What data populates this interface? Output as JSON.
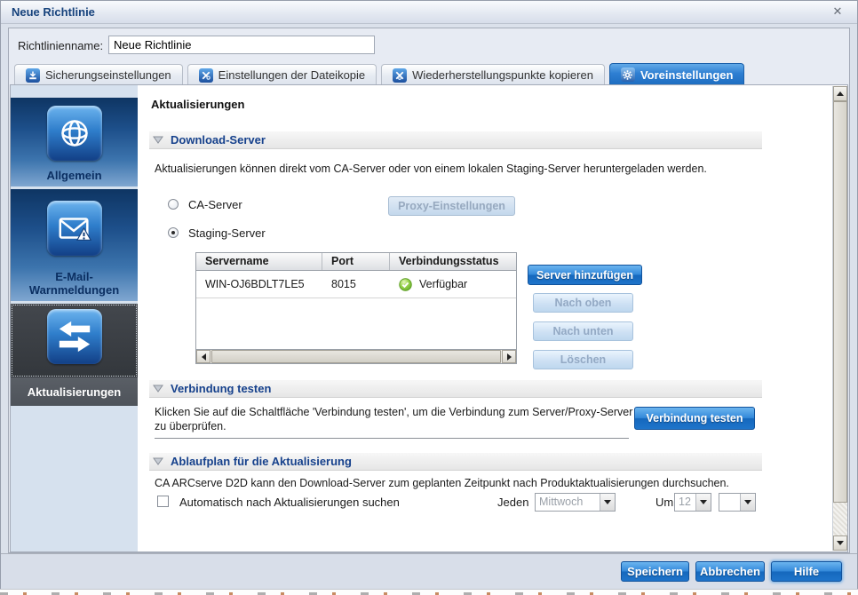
{
  "window": {
    "title": "Neue Richtlinie"
  },
  "form": {
    "policy_name_label": "Richtlinienname:",
    "policy_name_value": "Neue Richtlinie"
  },
  "tabs": [
    {
      "label": "Sicherungseinstellungen"
    },
    {
      "label": "Einstellungen der Dateikopie"
    },
    {
      "label": "Wiederherstellungspunkte kopieren"
    },
    {
      "label": "Voreinstellungen"
    }
  ],
  "sidebar": [
    {
      "label": "Allgemein"
    },
    {
      "label": "E-Mail-\nWarnmeldungen"
    },
    {
      "label": "Aktualisierungen"
    }
  ],
  "main": {
    "heading": "Aktualisierungen",
    "download_server": {
      "title": "Download-Server",
      "description": "Aktualisierungen können direkt vom CA-Server oder von einem lokalen Staging-Server heruntergeladen werden.",
      "radio_ca_label": "CA-Server",
      "proxy_button_label": "Proxy-Einstellungen",
      "radio_staging_label": "Staging-Server",
      "table": {
        "headers": [
          "Servername",
          "Port",
          "Verbindungsstatus"
        ],
        "row": {
          "servername": "WIN-OJ6BDLT7LE5",
          "port": "8015",
          "status": "Verfügbar"
        }
      },
      "add_button_label": "Server hinzufügen",
      "up_button_label": "Nach oben",
      "down_button_label": "Nach unten",
      "delete_button_label": "Löschen"
    },
    "test_connection": {
      "title": "Verbindung testen",
      "description": "Klicken Sie auf die Schaltfläche 'Verbindung testen', um die Verbindung zum Server/Proxy-Server zu überprüfen.",
      "button_label": "Verbindung testen"
    },
    "schedule": {
      "title": "Ablaufplan für die Aktualisierung",
      "description": "CA ARCserve D2D kann den Download-Server zum geplanten Zeitpunkt nach Produktaktualisierungen durchsuchen.",
      "checkbox_label": "Automatisch nach Aktualisierungen suchen",
      "every_label": "Jeden",
      "weekday_value": "Mittwoch",
      "at_label": "Um",
      "hour_value": "12",
      "minute_value": ""
    }
  },
  "footer": {
    "save_label": "Speichern",
    "cancel_label": "Abbrechen",
    "help_label": "Hilfe"
  },
  "colors": {
    "accent_blue": "#1e74ca",
    "active_tab_blue": "#2e7fd2",
    "status_green": "#76b82a",
    "header_navy": "#16418c"
  }
}
